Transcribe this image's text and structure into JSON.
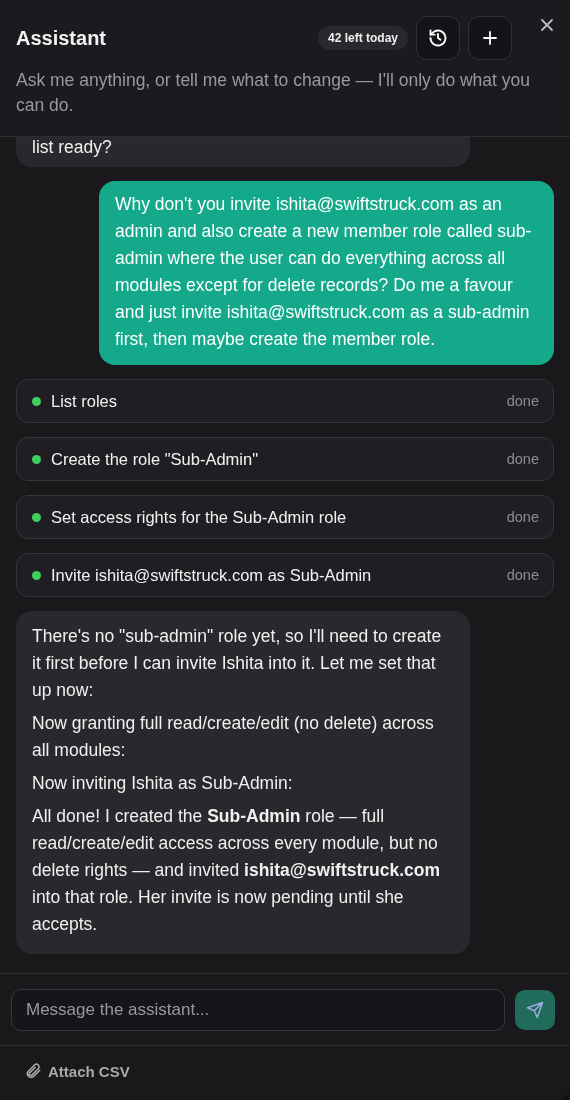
{
  "header": {
    "title": "Assistant",
    "quota": "42 left today",
    "subtitle": "Ask me anything, or tell me what to change — I'll only do what you can do."
  },
  "messages": [
    {
      "kind": "assistant",
      "paragraphs": [
        "list ready?"
      ]
    },
    {
      "kind": "user",
      "paragraphs": [
        "Why don't you invite ishita@swiftstruck.com as an admin and also create a new member role called sub-admin where the user can do everything across all modules except for delete records? Do me a favour and just invite ishita@swiftstruck.com as a sub-admin first, then maybe create the member role."
      ]
    },
    {
      "kind": "steps",
      "steps": [
        {
          "label": "List roles",
          "status": "done",
          "color": "#3fcf5e"
        },
        {
          "label": "Create the role \"Sub-Admin\"",
          "status": "done",
          "color": "#3fcf5e"
        },
        {
          "label": "Set access rights for the Sub-Admin role",
          "status": "done",
          "color": "#3fcf5e"
        },
        {
          "label": "Invite ishita@swiftstruck.com as Sub-Admin",
          "status": "done",
          "color": "#3fcf5e"
        }
      ]
    },
    {
      "kind": "assistant",
      "paragraphs": [
        "There's no \"sub-admin\" role yet, so I'll need to create it first before I can invite Ishita into it. Let me set that up now:",
        "Now granting full read/create/edit (no delete) across all modules:",
        "Now inviting Ishita as Sub-Admin:",
        "All done! I created the **Sub-Admin** role — full read/create/edit access across every module, but no delete rights — and invited **ishita@swiftstruck.com** into that role. Her invite is now pending until she accepts."
      ]
    }
  ],
  "composer": {
    "placeholder": "Message the assistant...",
    "attach": "Attach CSV"
  }
}
